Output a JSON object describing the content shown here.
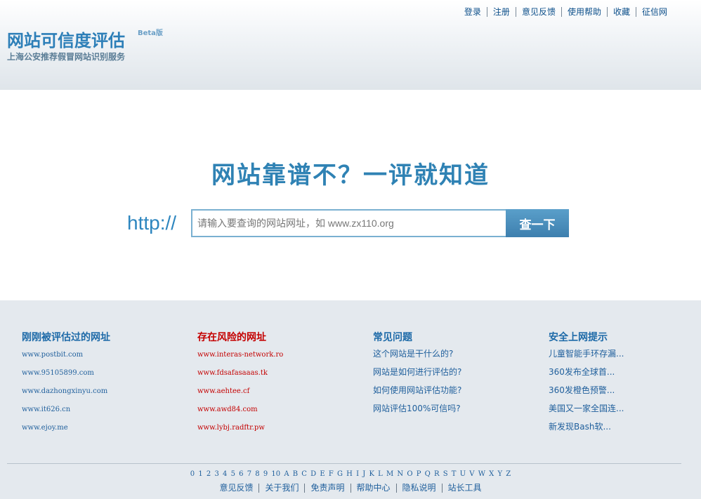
{
  "header": {
    "logo_title": "网站可信度评估",
    "logo_badge": "Beta版",
    "logo_subtitle": "上海公安推荐假冒网站识别服务",
    "nav": [
      "登录",
      "注册",
      "意见反馈",
      "使用帮助",
      "收藏",
      "征信网"
    ]
  },
  "search": {
    "slogan": "网站靠谱不？一评就知道",
    "prefix": "http://",
    "placeholder": "请输入要查询的网站网址，如 www.zx110.org",
    "value": "",
    "button_label": "查一下"
  },
  "columns": {
    "recent": {
      "title": "刚刚被评估过的网址",
      "items": [
        "www.postbit.com",
        "www.95105899.com",
        "www.dazhongxinyu.com",
        "www.it626.cn",
        "www.ejoy.me"
      ]
    },
    "risky": {
      "title": "存在风险的网址",
      "items": [
        "www.interas-network.ro",
        "www.fdsafasaaas.tk",
        "www.aehtee.cf",
        "www.awd84.com",
        "www.lybj.radftr.pw"
      ]
    },
    "faq": {
      "title": "常见问题",
      "items": [
        "这个网站是干什么的?",
        "网站是如何进行评估的?",
        "如何使用网站评估功能?",
        "网站评估100%可信吗?"
      ]
    },
    "safety": {
      "title": "安全上网提示",
      "items": [
        "儿童智能手环存漏...",
        "360发布全球首...",
        "360发橙色预警...",
        "美国又一家全国连...",
        "新发现Bash软..."
      ]
    }
  },
  "footer": {
    "index_chars": [
      "0",
      "1",
      "2",
      "3",
      "4",
      "5",
      "6",
      "7",
      "8",
      "9",
      "10",
      "A",
      "B",
      "C",
      "D",
      "E",
      "F",
      "G",
      "H",
      "I",
      "J",
      "K",
      "L",
      "M",
      "N",
      "O",
      "P",
      "Q",
      "R",
      "S",
      "T",
      "U",
      "V",
      "W",
      "X",
      "Y",
      "Z"
    ],
    "links": [
      "意见反馈",
      "关于我们",
      "免责声明",
      "帮助中心",
      "隐私说明",
      "站长工具"
    ]
  },
  "colors": {
    "brand_blue": "#2f82b4",
    "risk_red": "#c40000",
    "panel_bg": "#e4e9ee"
  }
}
